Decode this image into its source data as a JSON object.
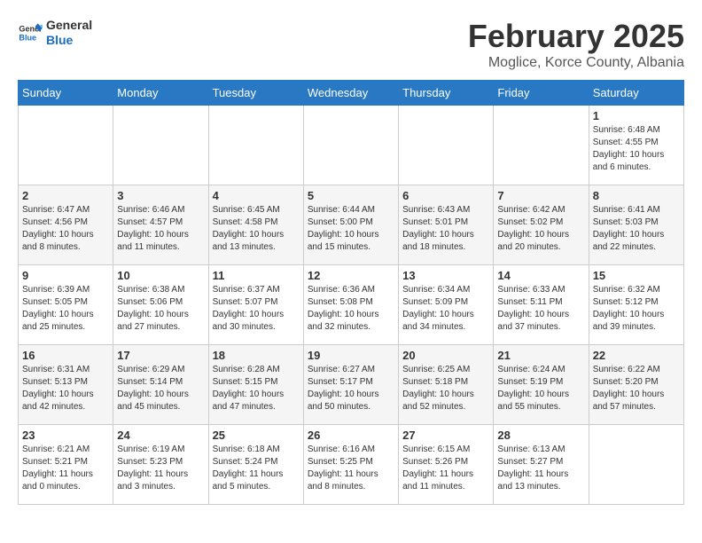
{
  "header": {
    "logo_text_general": "General",
    "logo_text_blue": "Blue",
    "month_title": "February 2025",
    "location": "Moglice, Korce County, Albania"
  },
  "weekdays": [
    "Sunday",
    "Monday",
    "Tuesday",
    "Wednesday",
    "Thursday",
    "Friday",
    "Saturday"
  ],
  "weeks": [
    [
      {
        "day": "",
        "info": ""
      },
      {
        "day": "",
        "info": ""
      },
      {
        "day": "",
        "info": ""
      },
      {
        "day": "",
        "info": ""
      },
      {
        "day": "",
        "info": ""
      },
      {
        "day": "",
        "info": ""
      },
      {
        "day": "1",
        "info": "Sunrise: 6:48 AM\nSunset: 4:55 PM\nDaylight: 10 hours and 6 minutes."
      }
    ],
    [
      {
        "day": "2",
        "info": "Sunrise: 6:47 AM\nSunset: 4:56 PM\nDaylight: 10 hours and 8 minutes."
      },
      {
        "day": "3",
        "info": "Sunrise: 6:46 AM\nSunset: 4:57 PM\nDaylight: 10 hours and 11 minutes."
      },
      {
        "day": "4",
        "info": "Sunrise: 6:45 AM\nSunset: 4:58 PM\nDaylight: 10 hours and 13 minutes."
      },
      {
        "day": "5",
        "info": "Sunrise: 6:44 AM\nSunset: 5:00 PM\nDaylight: 10 hours and 15 minutes."
      },
      {
        "day": "6",
        "info": "Sunrise: 6:43 AM\nSunset: 5:01 PM\nDaylight: 10 hours and 18 minutes."
      },
      {
        "day": "7",
        "info": "Sunrise: 6:42 AM\nSunset: 5:02 PM\nDaylight: 10 hours and 20 minutes."
      },
      {
        "day": "8",
        "info": "Sunrise: 6:41 AM\nSunset: 5:03 PM\nDaylight: 10 hours and 22 minutes."
      }
    ],
    [
      {
        "day": "9",
        "info": "Sunrise: 6:39 AM\nSunset: 5:05 PM\nDaylight: 10 hours and 25 minutes."
      },
      {
        "day": "10",
        "info": "Sunrise: 6:38 AM\nSunset: 5:06 PM\nDaylight: 10 hours and 27 minutes."
      },
      {
        "day": "11",
        "info": "Sunrise: 6:37 AM\nSunset: 5:07 PM\nDaylight: 10 hours and 30 minutes."
      },
      {
        "day": "12",
        "info": "Sunrise: 6:36 AM\nSunset: 5:08 PM\nDaylight: 10 hours and 32 minutes."
      },
      {
        "day": "13",
        "info": "Sunrise: 6:34 AM\nSunset: 5:09 PM\nDaylight: 10 hours and 34 minutes."
      },
      {
        "day": "14",
        "info": "Sunrise: 6:33 AM\nSunset: 5:11 PM\nDaylight: 10 hours and 37 minutes."
      },
      {
        "day": "15",
        "info": "Sunrise: 6:32 AM\nSunset: 5:12 PM\nDaylight: 10 hours and 39 minutes."
      }
    ],
    [
      {
        "day": "16",
        "info": "Sunrise: 6:31 AM\nSunset: 5:13 PM\nDaylight: 10 hours and 42 minutes."
      },
      {
        "day": "17",
        "info": "Sunrise: 6:29 AM\nSunset: 5:14 PM\nDaylight: 10 hours and 45 minutes."
      },
      {
        "day": "18",
        "info": "Sunrise: 6:28 AM\nSunset: 5:15 PM\nDaylight: 10 hours and 47 minutes."
      },
      {
        "day": "19",
        "info": "Sunrise: 6:27 AM\nSunset: 5:17 PM\nDaylight: 10 hours and 50 minutes."
      },
      {
        "day": "20",
        "info": "Sunrise: 6:25 AM\nSunset: 5:18 PM\nDaylight: 10 hours and 52 minutes."
      },
      {
        "day": "21",
        "info": "Sunrise: 6:24 AM\nSunset: 5:19 PM\nDaylight: 10 hours and 55 minutes."
      },
      {
        "day": "22",
        "info": "Sunrise: 6:22 AM\nSunset: 5:20 PM\nDaylight: 10 hours and 57 minutes."
      }
    ],
    [
      {
        "day": "23",
        "info": "Sunrise: 6:21 AM\nSunset: 5:21 PM\nDaylight: 11 hours and 0 minutes."
      },
      {
        "day": "24",
        "info": "Sunrise: 6:19 AM\nSunset: 5:23 PM\nDaylight: 11 hours and 3 minutes."
      },
      {
        "day": "25",
        "info": "Sunrise: 6:18 AM\nSunset: 5:24 PM\nDaylight: 11 hours and 5 minutes."
      },
      {
        "day": "26",
        "info": "Sunrise: 6:16 AM\nSunset: 5:25 PM\nDaylight: 11 hours and 8 minutes."
      },
      {
        "day": "27",
        "info": "Sunrise: 6:15 AM\nSunset: 5:26 PM\nDaylight: 11 hours and 11 minutes."
      },
      {
        "day": "28",
        "info": "Sunrise: 6:13 AM\nSunset: 5:27 PM\nDaylight: 11 hours and 13 minutes."
      },
      {
        "day": "",
        "info": ""
      }
    ]
  ]
}
